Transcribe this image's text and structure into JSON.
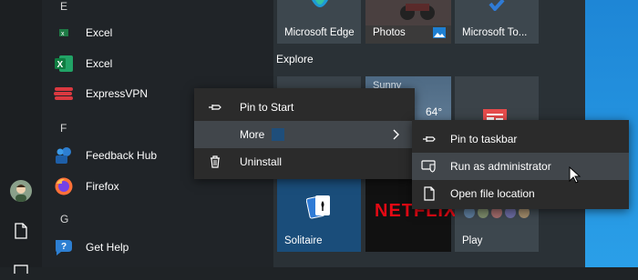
{
  "app_list": {
    "items": [
      {
        "type": "letter",
        "text": "E"
      },
      {
        "type": "app",
        "label": "Excel",
        "icon": "excel-small-icon"
      },
      {
        "type": "app",
        "label": "Excel",
        "icon": "excel-icon"
      },
      {
        "type": "app",
        "label": "ExpressVPN",
        "icon": "expressvpn-icon"
      },
      {
        "type": "letter",
        "text": "F"
      },
      {
        "type": "app",
        "label": "Feedback Hub",
        "icon": "feedback-hub-icon"
      },
      {
        "type": "app",
        "label": "Firefox",
        "icon": "firefox-icon"
      },
      {
        "type": "letter",
        "text": "G"
      },
      {
        "type": "app",
        "label": "Get Help",
        "icon": "get-help-icon"
      }
    ]
  },
  "tiles": {
    "top_row": [
      "Microsoft Edge",
      "Photos",
      "Microsoft To..."
    ],
    "section_label": "Explore",
    "weather": {
      "location_partial": "Sunny",
      "temp": "64°"
    },
    "netflix": "NETFLIX",
    "bottom_row": [
      "Solitaire",
      "Play"
    ]
  },
  "context_menu": {
    "items": [
      {
        "label": "Pin to Start",
        "icon": "pin-icon"
      },
      {
        "label": "More",
        "icon": "chevron-right-icon",
        "highlighted": true
      },
      {
        "label": "Uninstall",
        "icon": "trash-icon"
      }
    ]
  },
  "submenu": {
    "items": [
      {
        "label": "Pin to taskbar",
        "icon": "pin-icon"
      },
      {
        "label": "Run as administrator",
        "icon": "shield-icon",
        "highlighted": true
      },
      {
        "label": "Open file location",
        "icon": "folder-icon"
      }
    ]
  },
  "colors": {
    "accent": "#1e86d6",
    "highlight": "#41464b",
    "menu_bg": "#2b2b2b"
  }
}
